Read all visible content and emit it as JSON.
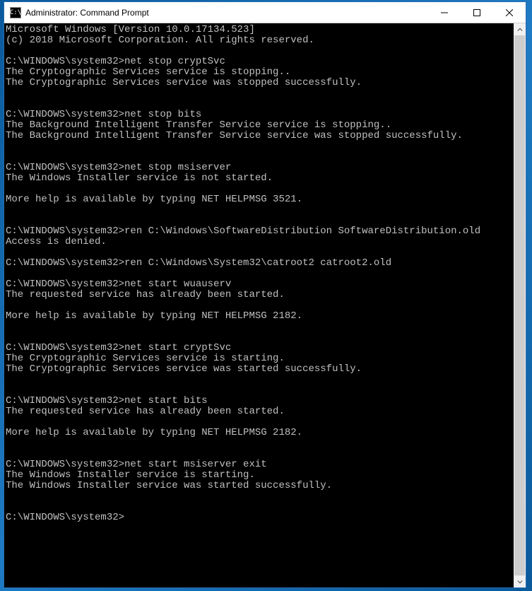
{
  "titlebar": {
    "icon_text": "C:\\",
    "title": "Administrator: Command Prompt"
  },
  "terminal": {
    "lines": [
      "Microsoft Windows [Version 10.0.17134.523]",
      "(c) 2018 Microsoft Corporation. All rights reserved.",
      "",
      "C:\\WINDOWS\\system32>net stop cryptSvc",
      "The Cryptographic Services service is stopping..",
      "The Cryptographic Services service was stopped successfully.",
      "",
      "",
      "C:\\WINDOWS\\system32>net stop bits",
      "The Background Intelligent Transfer Service service is stopping..",
      "The Background Intelligent Transfer Service service was stopped successfully.",
      "",
      "",
      "C:\\WINDOWS\\system32>net stop msiserver",
      "The Windows Installer service is not started.",
      "",
      "More help is available by typing NET HELPMSG 3521.",
      "",
      "",
      "C:\\WINDOWS\\system32>ren C:\\Windows\\SoftwareDistribution SoftwareDistribution.old",
      "Access is denied.",
      "",
      "C:\\WINDOWS\\system32>ren C:\\Windows\\System32\\catroot2 catroot2.old",
      "",
      "C:\\WINDOWS\\system32>net start wuauserv",
      "The requested service has already been started.",
      "",
      "More help is available by typing NET HELPMSG 2182.",
      "",
      "",
      "C:\\WINDOWS\\system32>net start cryptSvc",
      "The Cryptographic Services service is starting.",
      "The Cryptographic Services service was started successfully.",
      "",
      "",
      "C:\\WINDOWS\\system32>net start bits",
      "The requested service has already been started.",
      "",
      "More help is available by typing NET HELPMSG 2182.",
      "",
      "",
      "C:\\WINDOWS\\system32>net start msiserver exit",
      "The Windows Installer service is starting.",
      "The Windows Installer service was started successfully.",
      "",
      "",
      "C:\\WINDOWS\\system32>",
      ""
    ]
  }
}
